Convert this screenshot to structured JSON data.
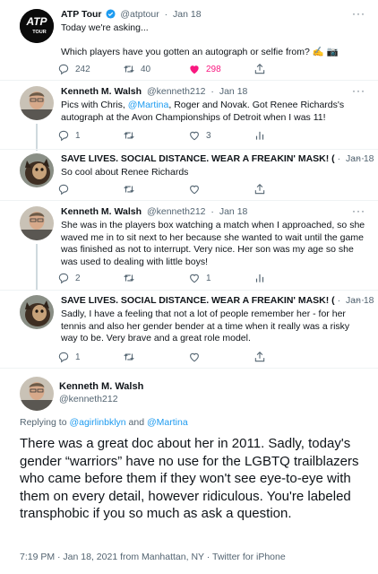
{
  "tweets": [
    {
      "name": "ATP Tour",
      "handle": "@atptour",
      "time": "Jan 18",
      "verified": true,
      "avatar_text": "ATP TOUR",
      "text_line1": "Today we're asking...",
      "text_line2": "Which players have you gotten an autograph or selfie from? ✍️ 📷",
      "replies": "242",
      "retweets": "40",
      "likes": "298"
    },
    {
      "name": "Kenneth M. Walsh",
      "handle": "@kenneth212",
      "time": "Jan 18",
      "text_a": "Pics with Chris, ",
      "mention": "@Martina",
      "text_b": ", Roger and Novak. Got Renee Richards's autograph at the Avon Championships of Detroit when I was 11!",
      "replies": "1",
      "retweets": "",
      "likes": "3"
    },
    {
      "name": "SAVE LIVES. SOCIAL DISTANCE. WEAR A FREAKIN' MASK! (",
      "handle": "·",
      "time": "Jan 18",
      "text": "So cool about Renee Richards",
      "replies": "",
      "retweets": "",
      "likes": ""
    },
    {
      "name": "Kenneth M. Walsh",
      "handle": "@kenneth212",
      "time": "Jan 18",
      "text": "She was in the players box watching a match when I approached, so she waved me in to sit next to her because she wanted to wait until the game was finished as not to interrupt. Very nice. Her son was my age so she was used to dealing with little boys!",
      "replies": "2",
      "retweets": "",
      "likes": "1"
    },
    {
      "name": "SAVE LIVES. SOCIAL DISTANCE. WEAR A FREAKIN' MASK! (",
      "handle": "·",
      "time": "Jan 18",
      "text": "Sadly, I have a feeling that not a lot of people remember her - for her tennis and also her gender bender at a time when it really was a risky way to be. Very brave and a great role model.",
      "replies": "1",
      "retweets": "",
      "likes": ""
    }
  ],
  "focus": {
    "name": "Kenneth M. Walsh",
    "handle": "@kenneth212",
    "replying_prefix": "Replying to ",
    "mention1": "@agirlinbklyn",
    "and": " and ",
    "mention2": "@Martina",
    "text": "There was a great doc about her in 2011. Sadly, today's gender “warriors” have no use for the LGBTQ trailblazers who came before them if they won't see eye-to-eye with them on every detail, however ridiculous. You're labeled transphobic if you so much as ask a question.",
    "meta": "7:19 PM · Jan 18, 2021 from Manhattan, NY · Twitter for iPhone"
  },
  "colors": {
    "accent": "#1d9bf0",
    "like": "#f91880",
    "muted": "#536471"
  }
}
